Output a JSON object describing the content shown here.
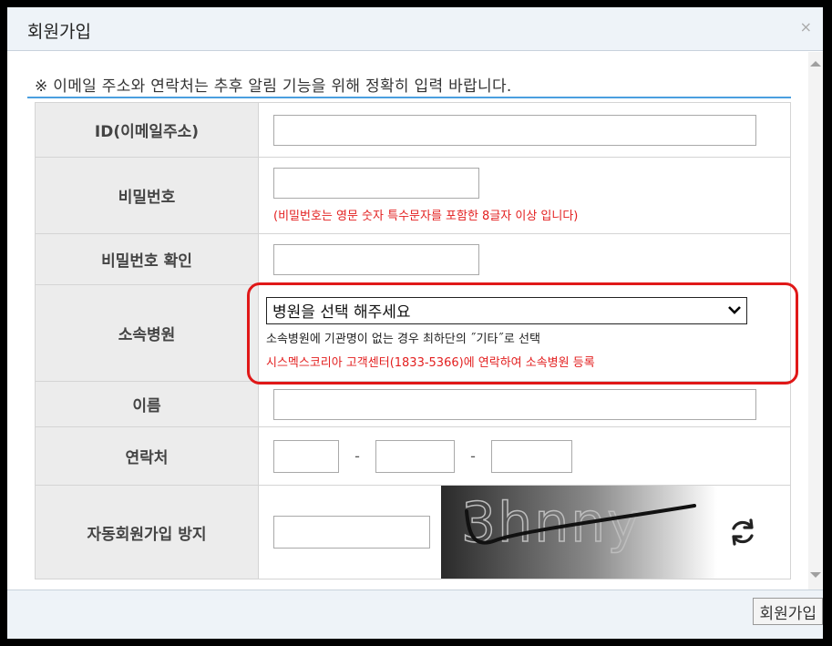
{
  "dialog": {
    "title": "회원가입",
    "close_icon": "×",
    "notice": "※ 이메일 주소와 연락처는 추후 알림 기능을 위해 정확히 입력 바랍니다."
  },
  "form": {
    "id_label": "ID(이메일주소)",
    "id_value": "",
    "password_label": "비밀번호",
    "password_value": "",
    "password_hint": "(비밀번호는 영문 숫자 특수문자를 포함한 8글자 이상 입니다)",
    "password_confirm_label": "비밀번호 확인",
    "password_confirm_value": "",
    "hospital_label": "소속병원",
    "hospital_selected": "병원을 선택 해주세요",
    "hospital_hint1": "소속병원에 기관명이 없는 경우 최하단의 ˝기타˝로 선택",
    "hospital_hint2": "시스멕스코리아 고객센터(1833-5366)에 연락하여 소속병원 등록",
    "name_label": "이름",
    "name_value": "",
    "phone_label": "연락처",
    "phone_separator": "-",
    "phone_parts": [
      "",
      "",
      ""
    ],
    "captcha_label": "자동회원가입 방지",
    "captcha_value": "",
    "captcha_text": "3hnny"
  },
  "footer": {
    "submit_label": "회원가입"
  },
  "colors": {
    "accent_line": "#4a9fdf",
    "warning_red": "#e32020",
    "label_bg": "#ececec",
    "titlebar_bg": "#eef3f8"
  },
  "icons": {
    "close": "close-icon",
    "dropdown": "chevron-down-icon",
    "refresh": "refresh-icon"
  }
}
